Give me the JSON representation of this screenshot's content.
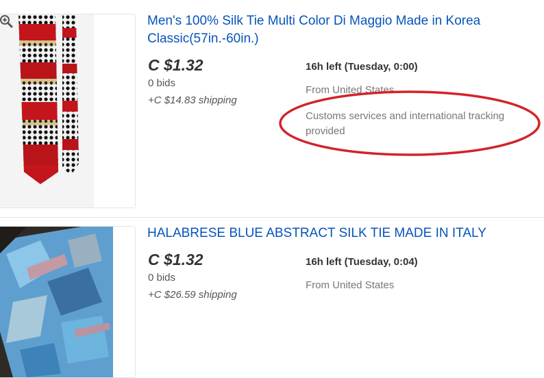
{
  "listings": [
    {
      "title": "Men's 100% Silk Tie Multi Color Di Maggio Made in Korea Classic(57in.-60in.)",
      "price": "C $1.32",
      "bids": "0 bids",
      "shipping": "+C $14.83 shipping",
      "time_left": "16h left (Tuesday, 0:00)",
      "location": "From United States",
      "extra_note": "Customs services and international tracking provided",
      "image_icon": "zoom-in-icon"
    },
    {
      "title": "HALABRESE BLUE ABSTRACT SILK TIE MADE IN ITALY",
      "price": "C $1.32",
      "bids": "0 bids",
      "shipping": "+C $26.59 shipping",
      "time_left": "16h left (Tuesday, 0:04)",
      "location": "From United States"
    }
  ],
  "colors": {
    "link": "#0654ba",
    "annotation_ellipse": "#d2232a",
    "divider": "#e5e5e5"
  }
}
